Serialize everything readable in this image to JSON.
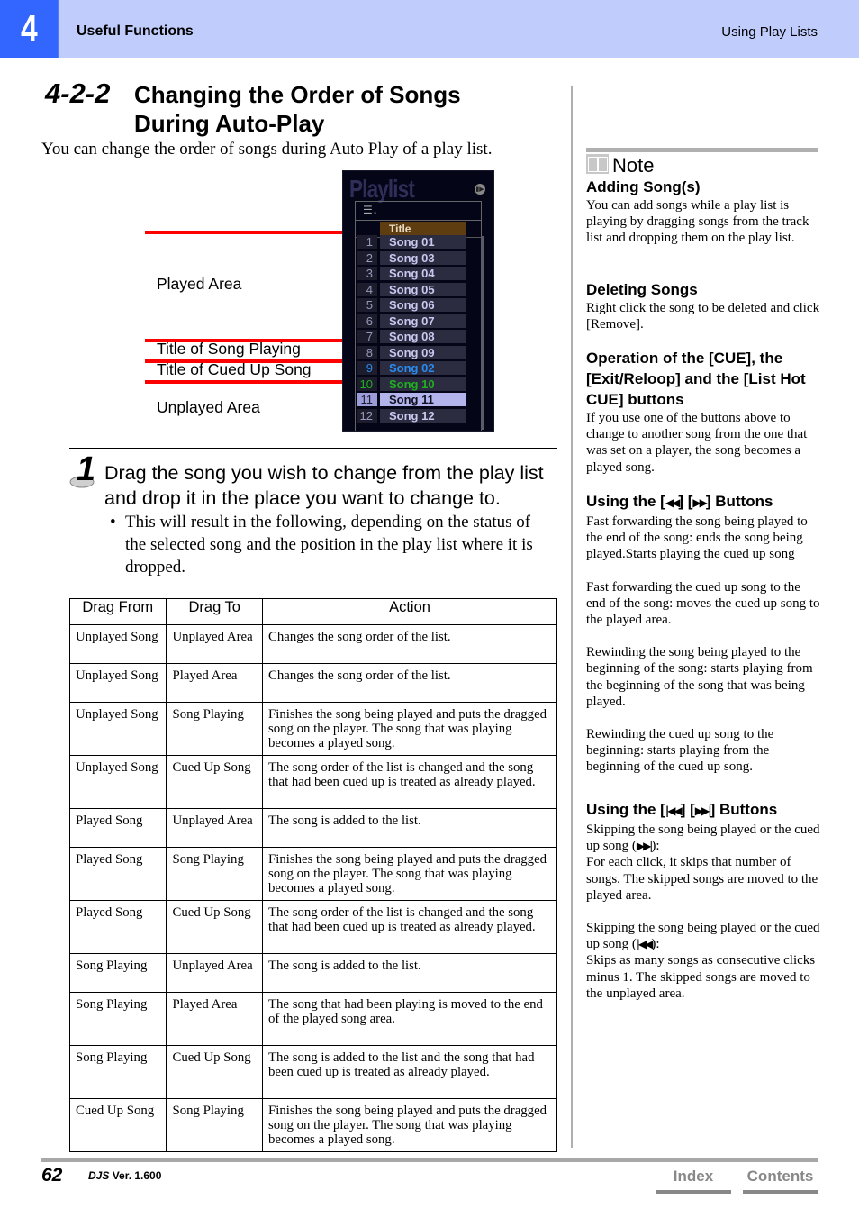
{
  "header": {
    "chapter_number": "4",
    "section": "Useful Functions",
    "topic": "Using Play Lists"
  },
  "title": {
    "number": "4-2-2",
    "text": "Changing the Order of Songs During Auto-Play"
  },
  "intro": "You can change the order of songs during Auto Play of a play list.",
  "figure": {
    "labels": {
      "played_area": "Played Area",
      "song_playing": "Title of Song Playing",
      "cued_up": "Title of Cued Up Song",
      "unplayed_area": "Unplayed Area"
    },
    "playlist": {
      "title": "Playlist",
      "column_header": "Title",
      "rows": [
        {
          "num": "1",
          "title": "Song 01",
          "state": "played"
        },
        {
          "num": "2",
          "title": "Song 03",
          "state": "played"
        },
        {
          "num": "3",
          "title": "Song 04",
          "state": "played"
        },
        {
          "num": "4",
          "title": "Song 05",
          "state": "played"
        },
        {
          "num": "5",
          "title": "Song 06",
          "state": "played"
        },
        {
          "num": "6",
          "title": "Song 07",
          "state": "played"
        },
        {
          "num": "7",
          "title": "Song 08",
          "state": "played"
        },
        {
          "num": "8",
          "title": "Song 09",
          "state": "played"
        },
        {
          "num": "9",
          "title": "Song 02",
          "state": "cued"
        },
        {
          "num": "10",
          "title": "Song 10",
          "state": "playing"
        },
        {
          "num": "11",
          "title": "Song 11",
          "state": "selected"
        },
        {
          "num": "12",
          "title": "Song 12",
          "state": "unplayed"
        }
      ]
    }
  },
  "step": {
    "number": "1",
    "text": "Drag the song you wish to change from the play list and drop it in the place you want to change to.",
    "bullet_symbol": "•",
    "bullet": "This will result in the following, depending on the status of the selected song and the position in the play list where it is dropped."
  },
  "table": {
    "headers": [
      "Drag From",
      "Drag To",
      "Action"
    ],
    "rows": [
      [
        "Unplayed Song",
        "Unplayed Area",
        "Changes the song order of the list."
      ],
      [
        "Unplayed Song",
        "Played Area",
        "Changes the song order of the list."
      ],
      [
        "Unplayed Song",
        "Song Playing",
        "Finishes the song being played and puts the dragged song on the player. The song that was playing becomes a played song."
      ],
      [
        "Unplayed Song",
        "Cued Up Song",
        "The song order of the list is changed and the song that had been cued up is treated as already played."
      ],
      [
        "Played Song",
        "Unplayed Area",
        "The song is added to the list."
      ],
      [
        "Played Song",
        "Song Playing",
        "Finishes the song being played and puts the dragged song on the player. The song that was playing becomes a played song."
      ],
      [
        "Played Song",
        "Cued Up Song",
        "The song order of the list is changed and the song that had been cued up is treated as already played."
      ],
      [
        "Song Playing",
        "Unplayed Area",
        "The song is added to the list."
      ],
      [
        "Song Playing",
        "Played Area",
        "The song that had been playing is moved to the end of the played song area."
      ],
      [
        "Song Playing",
        "Cued Up Song",
        "The song is added to the list and the song that had been cued up is treated as already played."
      ],
      [
        "Cued Up Song",
        "Song Playing",
        "Finishes the song being played and puts the dragged song on the player. The song that was playing becomes a played song."
      ]
    ]
  },
  "note": {
    "label": "Note",
    "sections": [
      {
        "heading": "Adding Song(s)",
        "paragraphs": [
          "You can add songs while a play list is playing by dragging songs from the track list and dropping them on the play list."
        ]
      },
      {
        "heading": "Deleting Songs",
        "paragraphs": [
          "Right click the song to be deleted and click [Remove]."
        ]
      },
      {
        "heading": "Operation of the [CUE], the [Exit/Reloop] and the [List Hot CUE] buttons",
        "paragraphs": [
          "If you use one of the buttons above to change to another song from the one that was set on a player, the song becomes a played song."
        ]
      },
      {
        "heading_prefix": "Using the [",
        "heading_mid": "] [",
        "heading_suffix": "] Buttons",
        "glyph_a": "◀◀",
        "glyph_b": "▶▶",
        "paragraphs": [
          "Fast forwarding the song being played to the end of the song: ends the song being played.Starts playing the cued up song",
          "Fast forwarding the cued up song to the end of the song: moves the cued up song to the played area.",
          "Rewinding the song being played to the beginning of the song: starts playing from the beginning of the song that was being played.",
          "Rewinding the cued up song to the beginning: starts playing from the beginning of the cued up song."
        ]
      },
      {
        "heading_prefix": "Using the [",
        "heading_mid": "] [",
        "heading_suffix": "] Buttons",
        "glyph_a": "|◀◀",
        "glyph_b": "▶▶|",
        "p1_a": "Skipping the song being played or the cued up song (",
        "p1_glyph": "▶▶|",
        "p1_b": "):",
        "p1_c": "For each click, it skips that number of songs. The skipped songs are moved to the played area.",
        "p2_a": "Skipping the song being played or the cued up song (",
        "p2_glyph": "|◀◀",
        "p2_b": "):",
        "p2_c": "Skips as many songs as consecutive clicks minus 1. The skipped songs are moved to the unplayed area."
      }
    ]
  },
  "footer": {
    "page": "62",
    "product": "DJS",
    "version": "Ver. 1.600",
    "index_link": "Index",
    "contents_link": "Contents"
  },
  "colors": {
    "header_band": "#c0cdfc",
    "chapter_box": "#3366ff",
    "annotation_line": "#ff0000",
    "cued_song": "#2a8cf0",
    "playing_song": "#20b020"
  }
}
